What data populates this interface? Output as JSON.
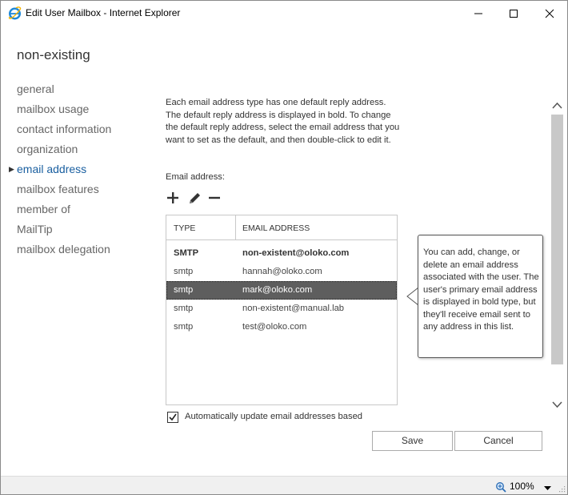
{
  "window": {
    "title": "Edit User Mailbox - Internet Explorer",
    "icon": "internet-explorer-icon"
  },
  "page": {
    "title": "non-existing"
  },
  "nav": {
    "items": [
      {
        "label": "general"
      },
      {
        "label": "mailbox usage"
      },
      {
        "label": "contact information"
      },
      {
        "label": "organization"
      },
      {
        "label": "email address",
        "active": true
      },
      {
        "label": "mailbox features"
      },
      {
        "label": "member of"
      },
      {
        "label": "MailTip"
      },
      {
        "label": "mailbox delegation"
      }
    ]
  },
  "main": {
    "description": "Each email address type has one default reply address. The default reply address is displayed in bold. To change the default reply address, select the email address that you want to set as the default, and then double-click to edit it.",
    "email_label": "Email address:",
    "toolbar": {
      "add_icon": "plus-icon",
      "edit_icon": "pencil-icon",
      "remove_icon": "minus-icon"
    },
    "table": {
      "headers": [
        "TYPE",
        "EMAIL ADDRESS"
      ],
      "rows": [
        {
          "type": "SMTP",
          "address": "non-existent@oloko.com",
          "bold": true
        },
        {
          "type": "smtp",
          "address": "hannah@oloko.com"
        },
        {
          "type": "smtp",
          "address": "mark@oloko.com",
          "selected": true
        },
        {
          "type": "smtp",
          "address": "non-existent@manual.lab"
        },
        {
          "type": "smtp",
          "address": "test@oloko.com"
        }
      ]
    },
    "callout": "You can add, change, or delete an email address associated with the user. The user's primary email address is displayed in bold type, but they'll receive email sent to any address in this list.",
    "auto_update_label": "Automatically update email addresses based",
    "auto_update_checked": true
  },
  "buttons": {
    "save": "Save",
    "cancel": "Cancel"
  },
  "statusbar": {
    "zoom": "100%"
  },
  "colors": {
    "accent": "#1a5fa0",
    "selected_row": "#5e5e5e",
    "scroll_thumb": "#c8c8c8"
  }
}
